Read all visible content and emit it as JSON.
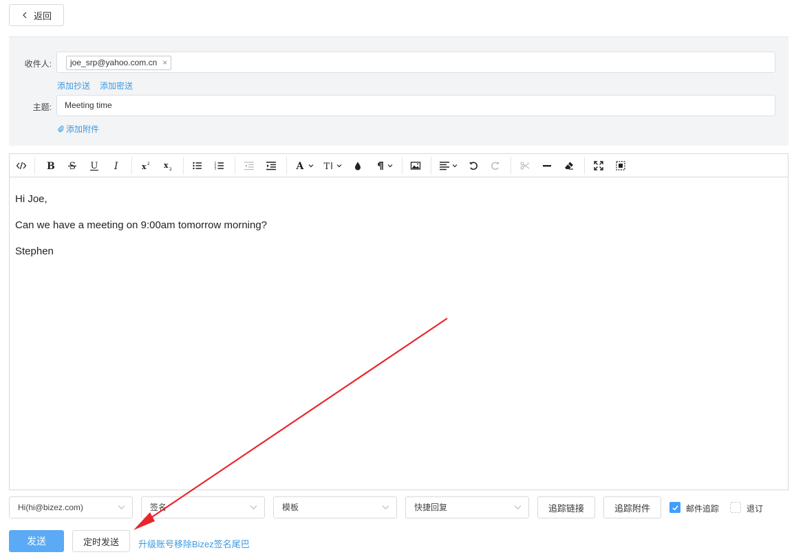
{
  "back": {
    "label": "返回"
  },
  "compose": {
    "to_label": "收件人:",
    "recipient": "joe_srp@yahoo.com.cn",
    "add_cc": "添加抄送",
    "add_bcc": "添加密送",
    "subject_label": "主题:",
    "subject_value": "Meeting time",
    "add_attachment": "添加附件"
  },
  "toolbar": {
    "icons": [
      "code-icon",
      "bold-icon",
      "strikethrough-icon",
      "underline-icon",
      "italic-icon",
      "superscript-icon",
      "subscript-icon",
      "bullet-list-icon",
      "numbered-list-icon",
      "outdent-icon",
      "indent-icon",
      "font-color-icon",
      "font-size-icon",
      "background-color-icon",
      "paragraph-icon",
      "image-icon",
      "align-icon",
      "undo-icon",
      "redo-icon",
      "cut-icon",
      "horizontal-rule-icon",
      "eraser-icon",
      "fullscreen-icon",
      "select-all-icon"
    ]
  },
  "body": {
    "lines": [
      "Hi Joe,",
      "Can we have a meeting on 9:00am tomorrow morning?",
      "Stephen"
    ]
  },
  "options": {
    "sender": "Hi(hi@bizez.com)",
    "signature": "签名",
    "template": "模板",
    "quick_reply": "快捷回复",
    "track_links": "追踪链接",
    "track_attachments": "追踪附件",
    "mail_tracking": "邮件追踪",
    "mail_tracking_checked": true,
    "unsubscribe": "退订",
    "unsubscribe_checked": false
  },
  "actions": {
    "send": "发送",
    "scheduled_send": "定时发送",
    "upgrade": "升级账号移除Bizez签名尾巴"
  },
  "colors": {
    "accent": "#409eff",
    "link": "#3b9ae1",
    "send_button": "#5aaaf5",
    "annotation_arrow": "#e8262c"
  }
}
